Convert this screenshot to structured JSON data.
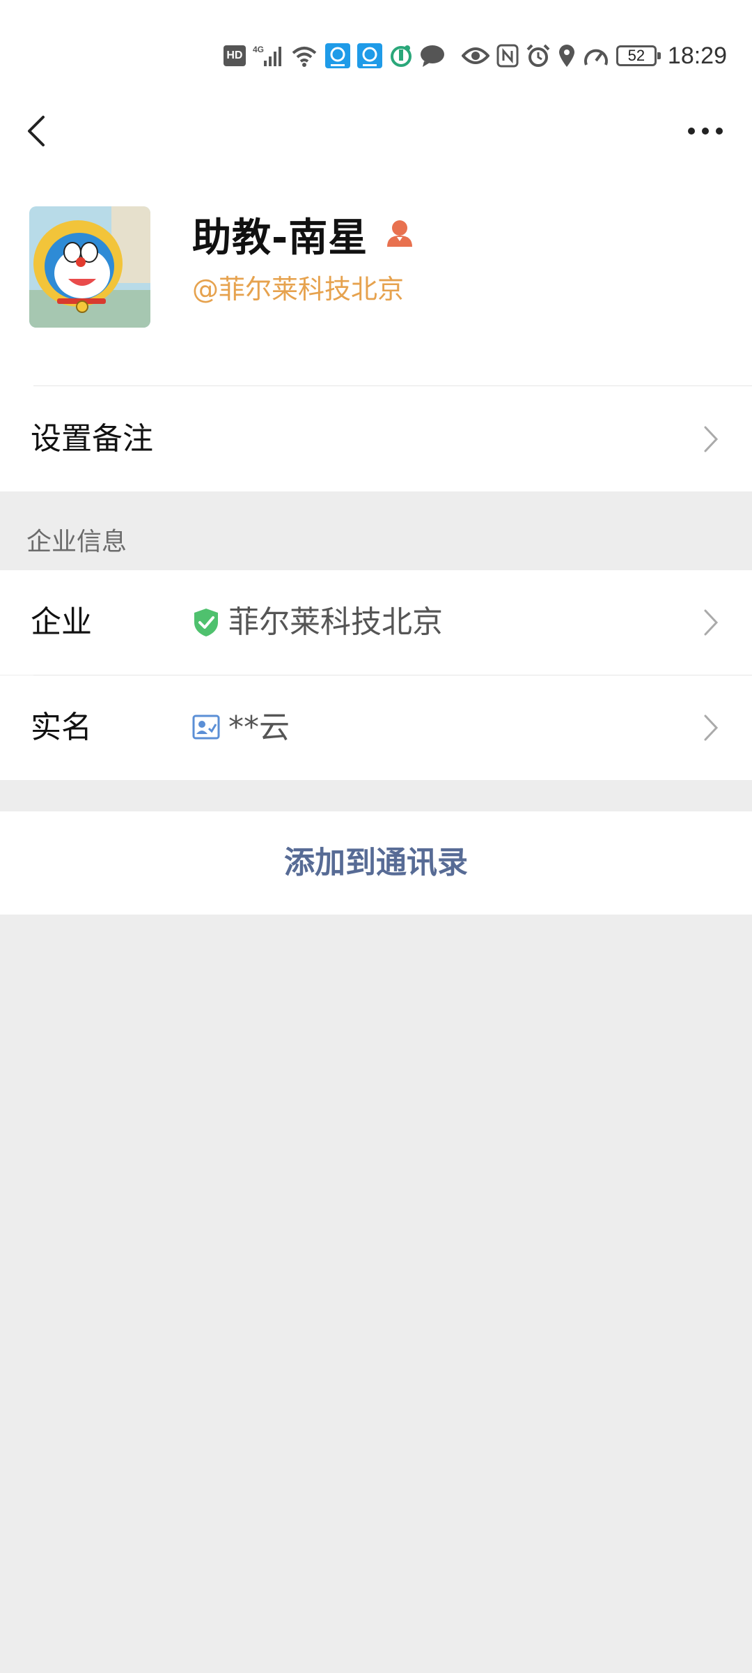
{
  "status_bar": {
    "time": "18:29",
    "battery": "52",
    "network": "4G",
    "hd_badge": "HD",
    "icons": [
      "hd-icon",
      "signal-4g-icon",
      "wifi-icon",
      "app-e-icon",
      "app-e-icon",
      "app-circle-icon",
      "chat-bubble-icon",
      "eye-icon",
      "nfc-icon",
      "alarm-icon",
      "location-icon",
      "speed-icon",
      "battery-icon"
    ]
  },
  "header": {
    "back_icon": "chevron-left-icon",
    "more_icon": "more-dots-icon"
  },
  "profile": {
    "name": "助教-南星",
    "organization": "@菲尔莱科技北京",
    "role_icon": "person-badge-icon",
    "role_color": "#e8714f",
    "org_color": "#e6a24e"
  },
  "remark_row": {
    "label": "设置备注"
  },
  "enterprise_section": {
    "title": "企业信息",
    "rows": [
      {
        "label": "企业",
        "value": "菲尔莱科技北京",
        "icon": "verified-shield-icon"
      },
      {
        "label": "实名",
        "value": "**云",
        "icon": "id-card-icon"
      }
    ]
  },
  "action": {
    "add_to_contacts": "添加到通讯录",
    "color": "#576b95"
  }
}
